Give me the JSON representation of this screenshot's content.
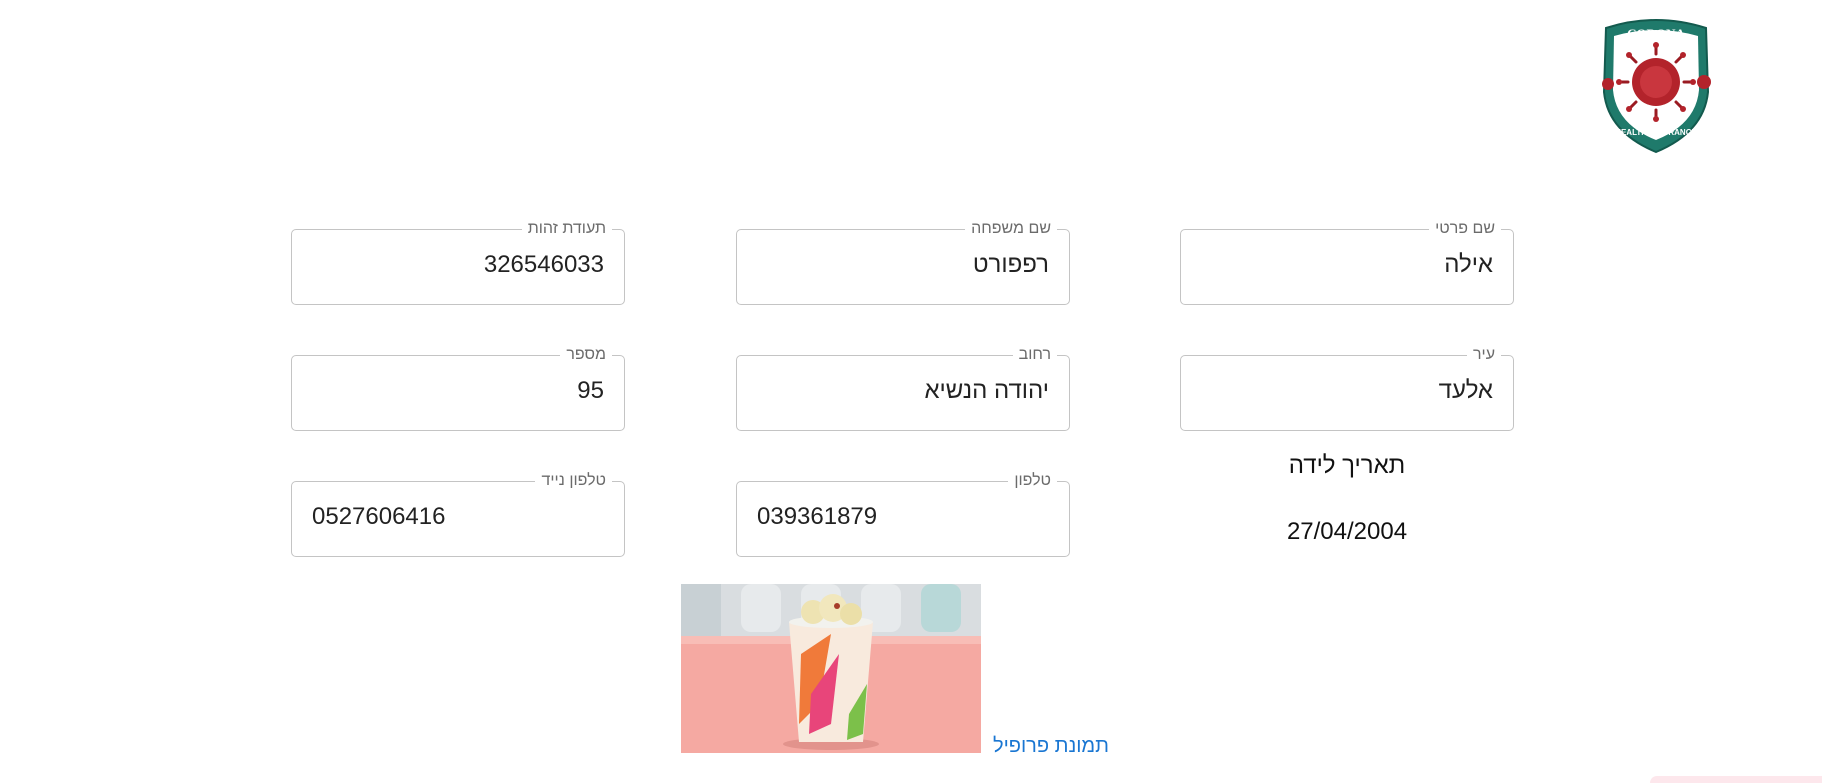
{
  "logo": {
    "top_text": "CORONA",
    "bottom_text": "HEALTH INSURANCE",
    "colors": {
      "shield": "#1f7a6b",
      "virus": "#b3232b"
    }
  },
  "fields": {
    "id_number": {
      "label": "תעודת זהות",
      "value": "326546033"
    },
    "last_name": {
      "label": "שם משפחה",
      "value": "רפפורט"
    },
    "first_name": {
      "label": "שם פרטי",
      "value": "אילה"
    },
    "house_number": {
      "label": "מספר",
      "value": "95"
    },
    "street": {
      "label": "רחוב",
      "value": "יהודה הנשיא"
    },
    "city": {
      "label": "עיר",
      "value": "אלעד"
    },
    "mobile_phone": {
      "label": "טלפון נייד",
      "value": "0527606416"
    },
    "phone": {
      "label": "טלפון",
      "value": "039361879"
    }
  },
  "birth_date": {
    "label": "תאריך לידה",
    "value": "27/04/2004"
  },
  "profile": {
    "link_label": "תמונת פרופיל",
    "image": "ice-cream-cup-photo"
  },
  "colors": {
    "link": "#1976d2",
    "field_border": "#c4c4c4"
  }
}
